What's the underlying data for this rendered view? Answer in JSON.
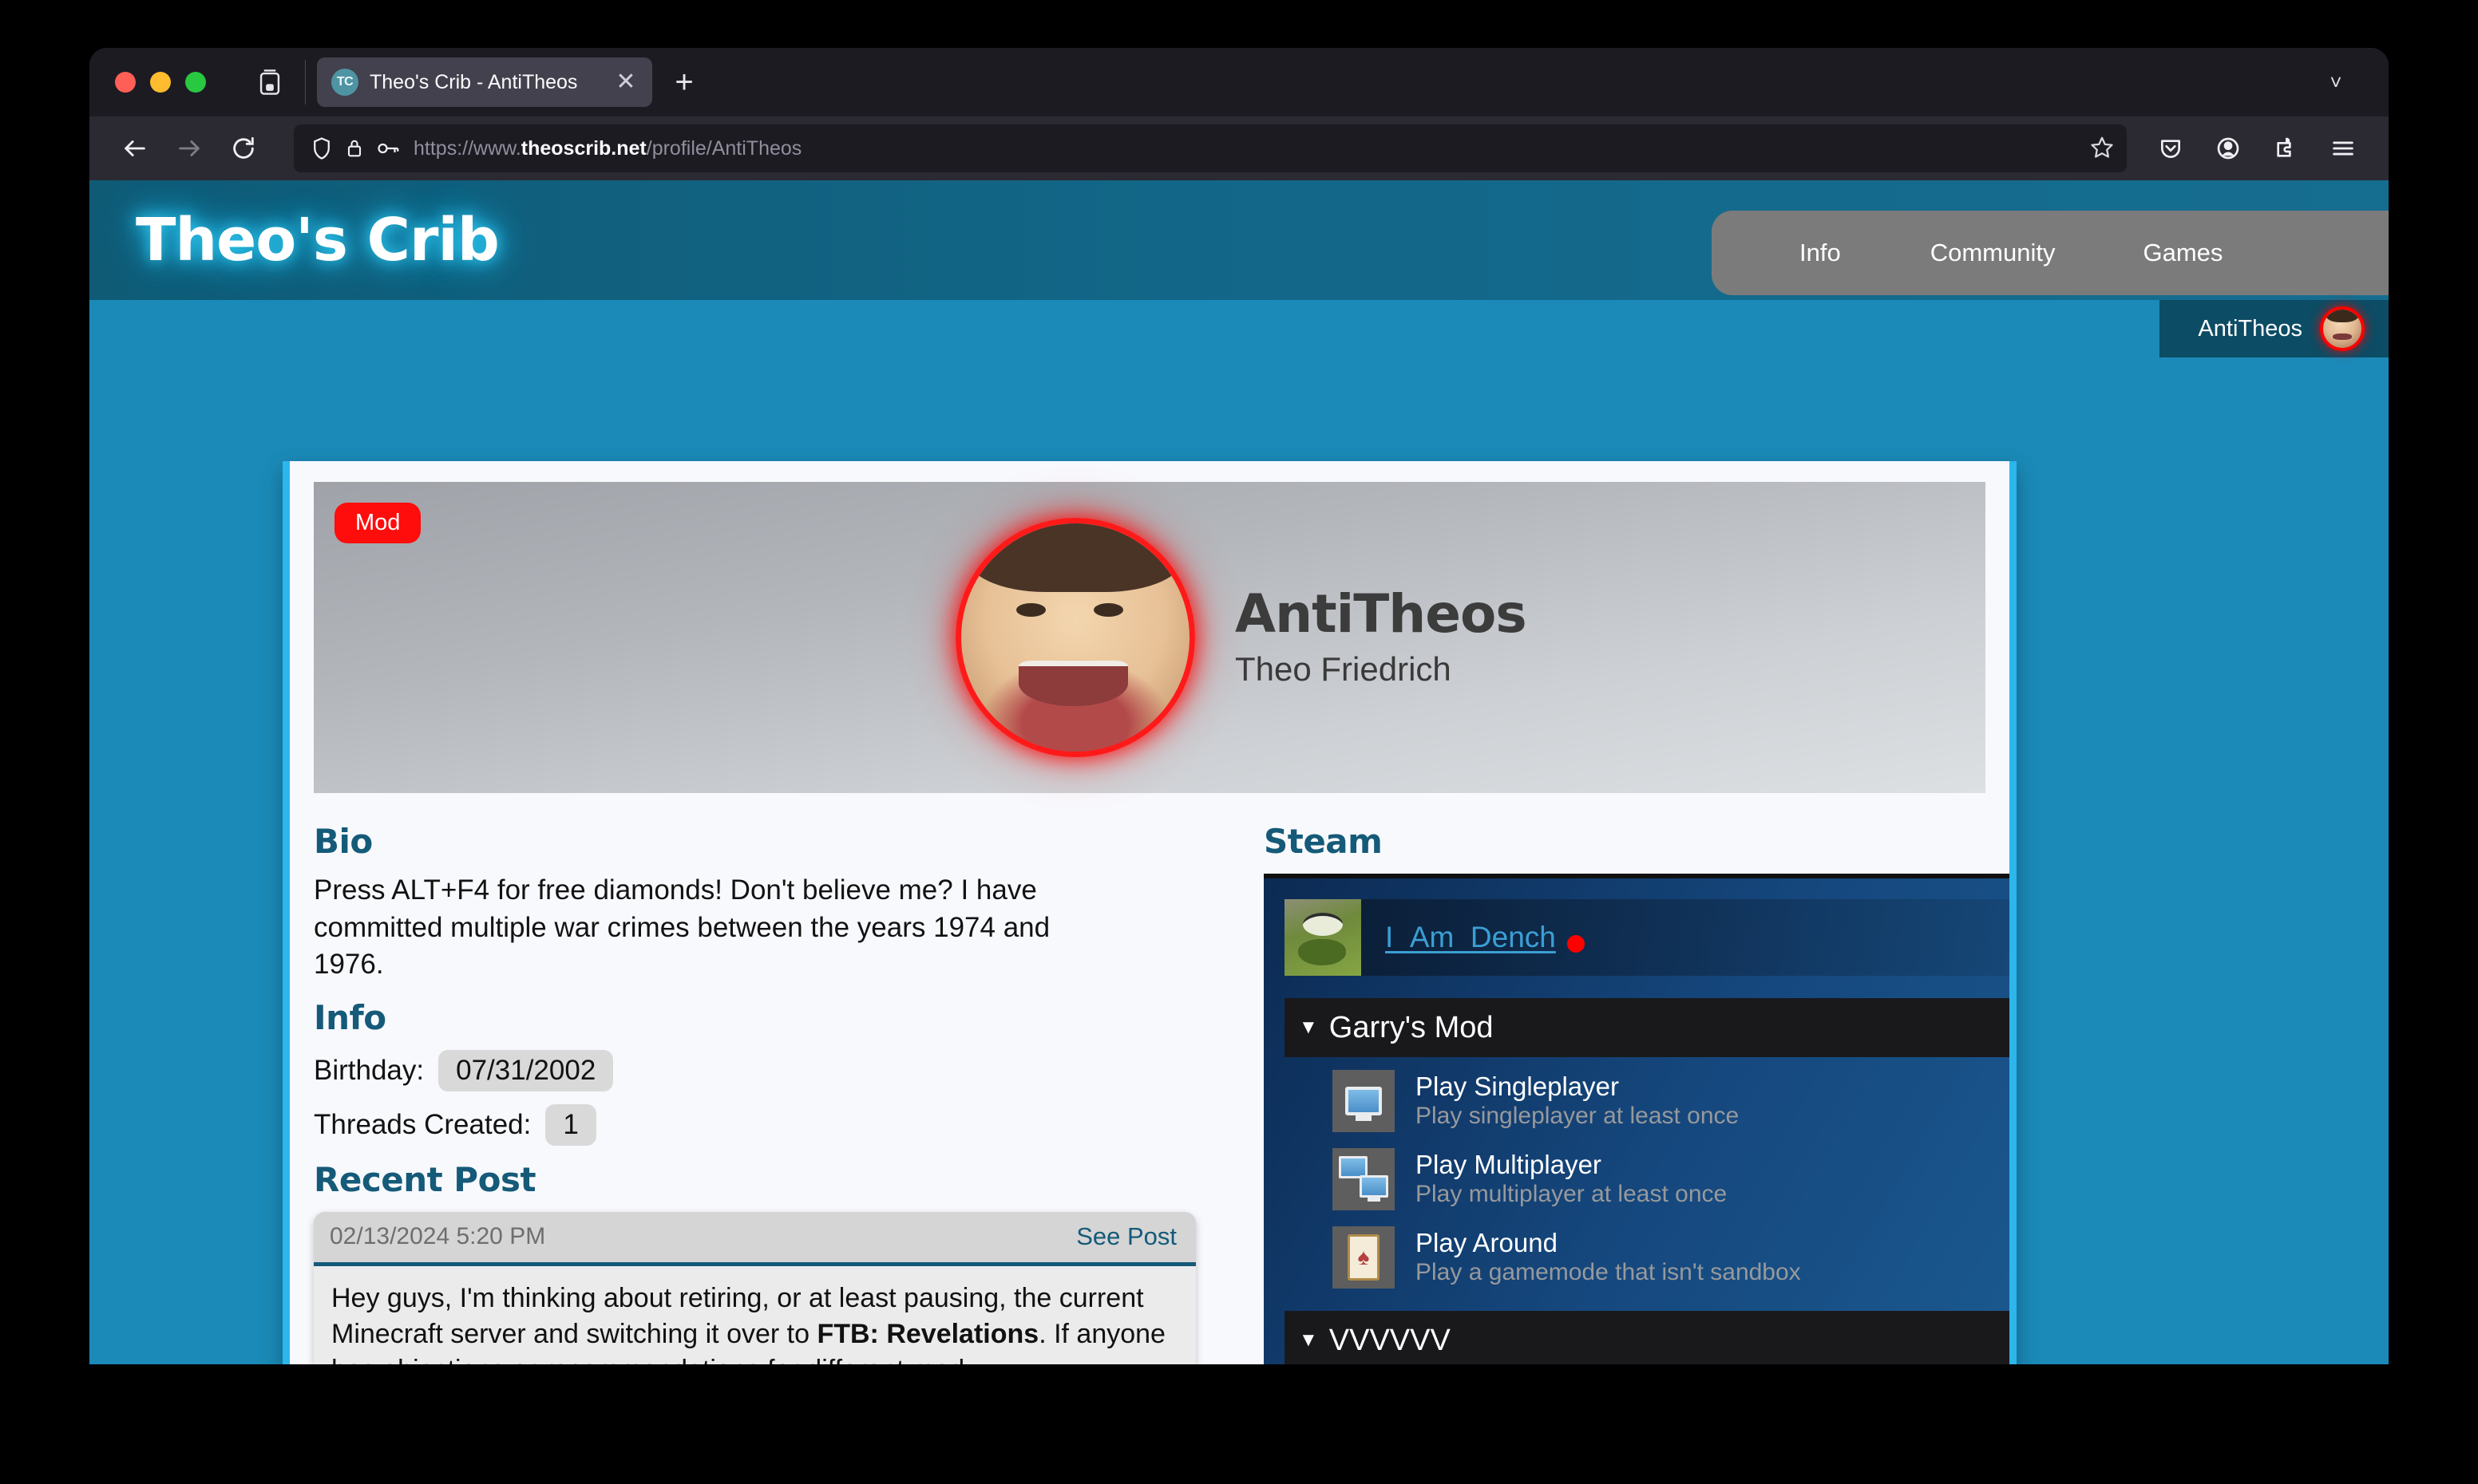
{
  "browser": {
    "tab": {
      "favicon_text": "TC",
      "title": "Theo's Crib - AntiTheos",
      "close_icon": "close-icon"
    },
    "newtab_label": "+",
    "url": {
      "prefix": "https://www.",
      "domain": "theoscrib.net",
      "path": "/profile/AntiTheos"
    }
  },
  "site": {
    "logo": "Theo's Crib",
    "nav": [
      "Info",
      "Community",
      "Games"
    ],
    "user": {
      "name": "AntiTheos"
    }
  },
  "profile": {
    "badge": "Mod",
    "handle": "AntiTheos",
    "real_name": "Theo Friedrich"
  },
  "bio": {
    "heading": "Bio",
    "text": "Press ALT+F4 for free diamonds! Don't believe me? I have committed multiple war crimes between the years 1974 and 1976."
  },
  "info": {
    "heading": "Info",
    "birthday_label": "Birthday:",
    "birthday_value": "07/31/2002",
    "threads_label": "Threads Created:",
    "threads_value": "1"
  },
  "recent_post": {
    "heading": "Recent Post",
    "date": "02/13/2024 5:20 PM",
    "see_post": "See Post",
    "body_part1": "Hey guys, I'm thinking about retiring, or at least pausing, the current Minecraft server and switching it over to ",
    "body_bold": "FTB: Revelations",
    "body_part2": ". If anyone has objections or recommendations for different mod"
  },
  "steam": {
    "heading": "Steam",
    "account_name": "I_Am_Dench",
    "status": "offline",
    "status_color": "#ff0000",
    "games": [
      {
        "title": "Garry's Mod",
        "expanded": true,
        "achievements": [
          {
            "name": "Play Singleplayer",
            "desc": "Play singleplayer at least once",
            "icon": "monitor-icon"
          },
          {
            "name": "Play Multiplayer",
            "desc": "Play multiplayer at least once",
            "icon": "dual-monitor-icon"
          },
          {
            "name": "Play Around",
            "desc": "Play a gamemode that isn't sandbox",
            "icon": "playing-card-icon"
          }
        ]
      },
      {
        "title": "VVVVVV",
        "expanded": true,
        "achievements": []
      }
    ]
  },
  "colors": {
    "accent_cyan": "#2cb6ec",
    "page_blue": "#1b8ab8",
    "header_blue": "#13688a",
    "heading_teal": "#155a79",
    "mod_red": "#ff0c0c"
  }
}
